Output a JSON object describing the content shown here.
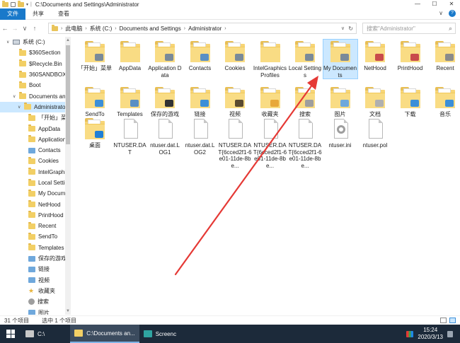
{
  "window": {
    "title": "C:\\Documents and Settings\\Administrator",
    "buttons": {
      "minimize": "—",
      "maximize": "☐",
      "close": "✕"
    }
  },
  "quick_access": {
    "separator": "|",
    "dropdown": "▾"
  },
  "ribbon": {
    "tabs": [
      {
        "label": "文件",
        "active": true
      },
      {
        "label": "共享",
        "active": false
      },
      {
        "label": "查看",
        "active": false
      }
    ],
    "expand": "∨",
    "help": "?"
  },
  "nav": {
    "back": "←",
    "forward": "→",
    "recent": "∨",
    "up": "↑"
  },
  "address": {
    "segments": [
      "此电脑",
      "系统 (C:)",
      "Documents and Settings",
      "Administrator"
    ],
    "separator": "›",
    "dropdown": "∨",
    "refresh": "↻"
  },
  "search": {
    "placeholder": "搜索\"Administrator\"",
    "icon": "⌕"
  },
  "sidebar": {
    "items": [
      {
        "label": "系统 (C:)",
        "icon": "drive-icon",
        "level": 0,
        "chevron": "∨",
        "selected": false
      },
      {
        "label": "$360Section",
        "icon": "folder-icon",
        "level": 1,
        "selected": false
      },
      {
        "label": "$Recycle.Bin",
        "icon": "folder-icon",
        "level": 1,
        "selected": false
      },
      {
        "label": "360SANDBOX",
        "icon": "folder-icon",
        "level": 1,
        "selected": false
      },
      {
        "label": "Boot",
        "icon": "folder-icon",
        "level": 1,
        "selected": false
      },
      {
        "label": "Documents and Settings",
        "icon": "folder-icon",
        "level": 1,
        "chevron": "∨",
        "selected": false
      },
      {
        "label": "Administrator",
        "icon": "folder-icon",
        "level": 2,
        "chevron": "∨",
        "selected": true
      },
      {
        "label": "「开始」菜单",
        "icon": "folder-icon",
        "level": 3,
        "selected": false
      },
      {
        "label": "AppData",
        "icon": "folder-icon",
        "level": 3,
        "selected": false
      },
      {
        "label": "Application Data",
        "icon": "folder-icon",
        "level": 3,
        "selected": false
      },
      {
        "label": "Contacts",
        "icon": "special-icon",
        "level": 3,
        "selected": false
      },
      {
        "label": "Cookies",
        "icon": "folder-icon",
        "level": 3,
        "selected": false
      },
      {
        "label": "IntelGraphicsProfiles",
        "icon": "folder-icon",
        "level": 3,
        "selected": false
      },
      {
        "label": "Local Settings",
        "icon": "folder-icon",
        "level": 3,
        "selected": false
      },
      {
        "label": "My Documents",
        "icon": "folder-icon",
        "level": 3,
        "selected": false
      },
      {
        "label": "NetHood",
        "icon": "folder-icon",
        "level": 3,
        "selected": false
      },
      {
        "label": "PrintHood",
        "icon": "folder-icon",
        "level": 3,
        "selected": false
      },
      {
        "label": "Recent",
        "icon": "folder-icon",
        "level": 3,
        "selected": false
      },
      {
        "label": "SendTo",
        "icon": "folder-icon",
        "level": 3,
        "selected": false
      },
      {
        "label": "Templates",
        "icon": "folder-icon",
        "level": 3,
        "selected": false
      },
      {
        "label": "保存的游戏",
        "icon": "special-icon",
        "level": 3,
        "selected": false
      },
      {
        "label": "链接",
        "icon": "special-icon",
        "level": 3,
        "selected": false
      },
      {
        "label": "视频",
        "icon": "special-icon",
        "level": 3,
        "selected": false
      },
      {
        "label": "收藏夹",
        "icon": "star-icon",
        "level": 3,
        "selected": false
      },
      {
        "label": "搜索",
        "icon": "gear-icon",
        "level": 3,
        "selected": false
      },
      {
        "label": "图片",
        "icon": "special-icon",
        "level": 3,
        "selected": false
      }
    ]
  },
  "files": [
    {
      "name": "「开始」菜单",
      "type": "folder",
      "badge": "#7a8a99",
      "selected": false
    },
    {
      "name": "AppData",
      "type": "folder",
      "badge": "",
      "selected": false
    },
    {
      "name": "Application Data",
      "type": "folder",
      "badge": "#7a8a99",
      "selected": false
    },
    {
      "name": "Contacts",
      "type": "folder",
      "badge": "#5a8fc4",
      "selected": false
    },
    {
      "name": "Cookies",
      "type": "folder",
      "badge": "#7a8a99",
      "selected": false
    },
    {
      "name": "IntelGraphicsProfiles",
      "type": "folder",
      "badge": "",
      "selected": false
    },
    {
      "name": "Local Settings",
      "type": "folder",
      "badge": "#7a8a99",
      "selected": false
    },
    {
      "name": "My Documents",
      "type": "folder",
      "badge": "#7a8a99",
      "selected": true
    },
    {
      "name": "NetHood",
      "type": "folder",
      "badge": "#c94b4b",
      "selected": false
    },
    {
      "name": "PrintHood",
      "type": "folder",
      "badge": "#c94b4b",
      "selected": false
    },
    {
      "name": "Recent",
      "type": "folder",
      "badge": "#8b8b8b",
      "selected": false
    },
    {
      "name": "SendTo",
      "type": "folder",
      "badge": "#3c8fd8",
      "selected": false
    },
    {
      "name": "Templates",
      "type": "folder",
      "badge": "#5a8fc4",
      "selected": false
    },
    {
      "name": "保存的游戏",
      "type": "folder",
      "badge": "#333333",
      "selected": false
    },
    {
      "name": "链接",
      "type": "folder",
      "badge": "#3c8fd8",
      "selected": false
    },
    {
      "name": "视频",
      "type": "folder",
      "badge": "#5a4a2f",
      "selected": false
    },
    {
      "name": "收藏夹",
      "type": "folder",
      "badge": "#e8a83a",
      "selected": false
    },
    {
      "name": "搜索",
      "type": "folder",
      "badge": "#9e9e9e",
      "selected": false
    },
    {
      "name": "图片",
      "type": "folder",
      "badge": "#6fa8dc",
      "selected": false
    },
    {
      "name": "文档",
      "type": "folder",
      "badge": "#b0b0b0",
      "selected": false
    },
    {
      "name": "下载",
      "type": "folder",
      "badge": "#3c8fd8",
      "selected": false
    },
    {
      "name": "音乐",
      "type": "folder",
      "badge": "#3c8fd8",
      "selected": false
    },
    {
      "name": "桌面",
      "type": "folder",
      "badge": "#1f7fd6",
      "selected": false
    },
    {
      "name": "NTUSER.DAT",
      "type": "file",
      "selected": false
    },
    {
      "name": "ntuser.dat.LOG1",
      "type": "file",
      "selected": false
    },
    {
      "name": "ntuser.dat.LOG2",
      "type": "file",
      "selected": false
    },
    {
      "name": "NTUSER.DAT{6cced2f1-6e01-11de-8be...",
      "type": "file",
      "selected": false
    },
    {
      "name": "NTUSER.DAT{6cced2f1-6e01-11de-8be...",
      "type": "file",
      "selected": false
    },
    {
      "name": "NTUSER.DAT{6cced2f1-6e01-11de-8be...",
      "type": "file",
      "selected": false
    },
    {
      "name": "ntuser.ini",
      "type": "ini",
      "selected": false
    },
    {
      "name": "ntuser.pol",
      "type": "file",
      "selected": false
    }
  ],
  "status": {
    "count": "31 个项目",
    "selected": "选中 1 个项目"
  },
  "taskbar": {
    "items": [
      {
        "label": "C:\\",
        "active": false,
        "icon": "#c8c8c8"
      },
      {
        "label": "C:\\Documents an...",
        "active": true,
        "icon": "#f2cf65"
      },
      {
        "label": "Screenc",
        "active": false,
        "icon": "#2fa4a1"
      }
    ],
    "time": "15:24",
    "date": "2020/3/13"
  },
  "colors": {
    "accent": "#1979ca",
    "selection": "#cce8ff",
    "annotation": "#e53935",
    "taskbar": "#1c2a3a"
  }
}
